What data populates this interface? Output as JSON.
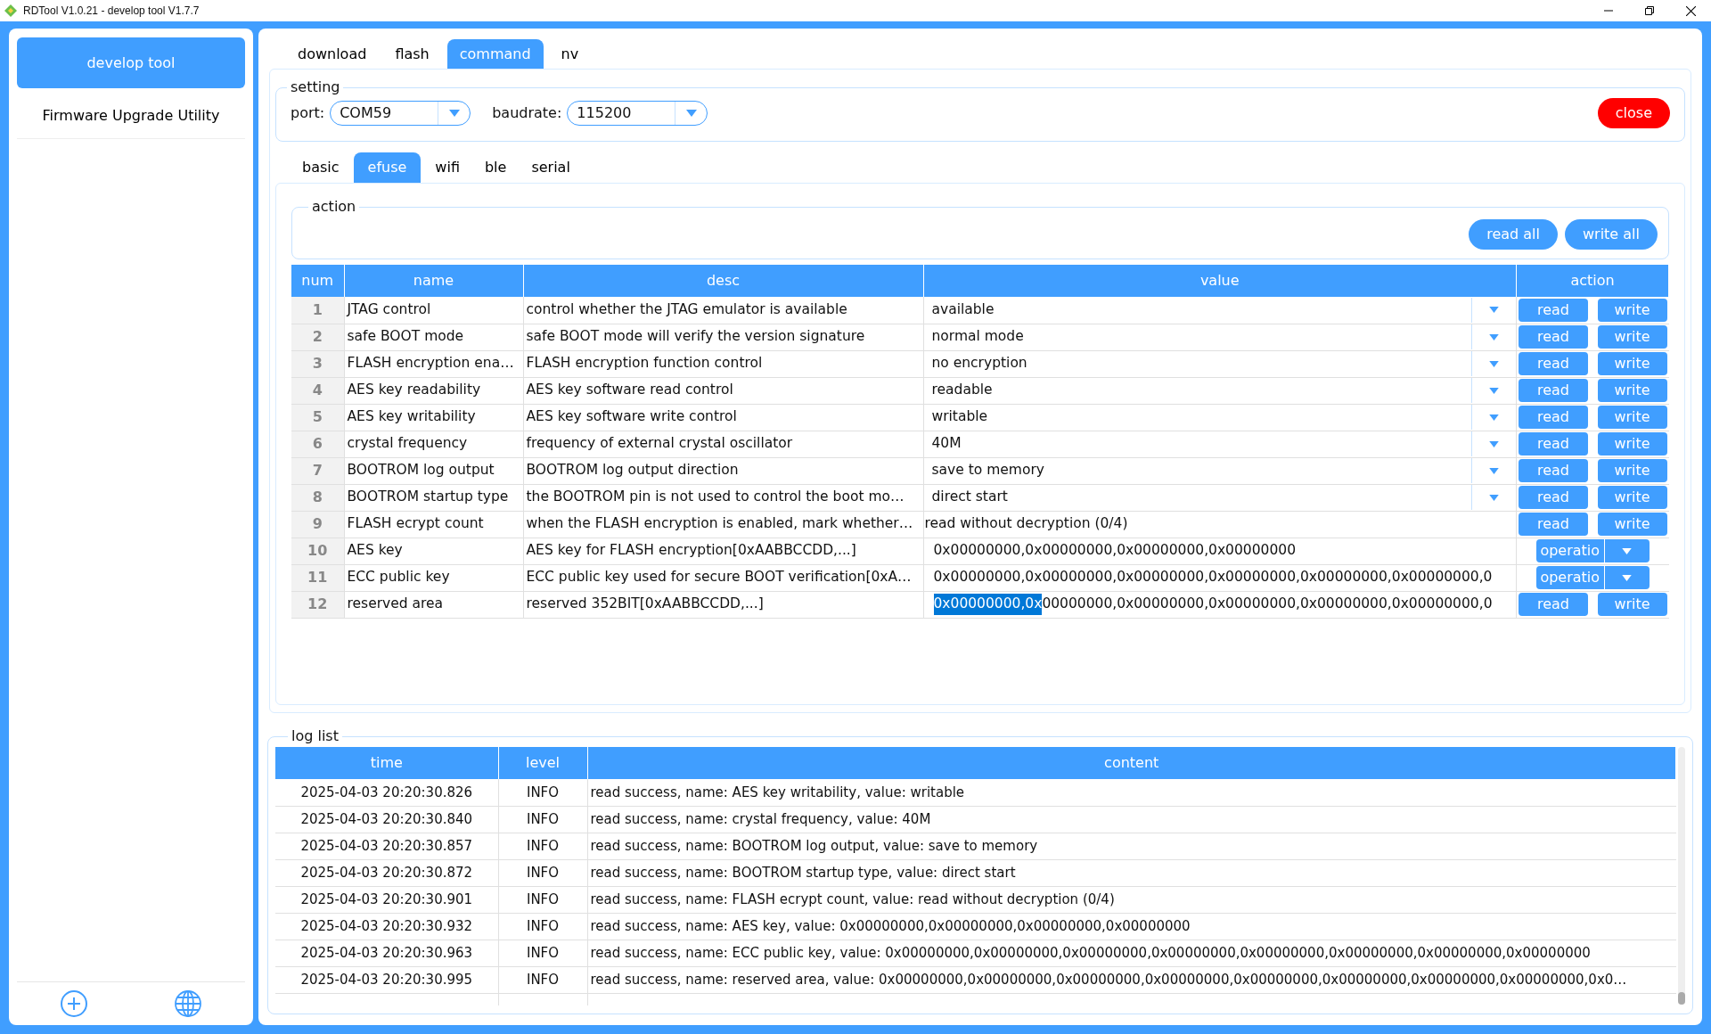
{
  "window": {
    "title": "RDTool V1.0.21 - develop tool V1.7.7"
  },
  "sidebar": {
    "items": [
      {
        "label": "develop tool",
        "selected": true
      },
      {
        "label": "Firmware Upgrade Utility",
        "selected": false
      }
    ]
  },
  "tabs": [
    {
      "label": "download",
      "selected": false
    },
    {
      "label": "flash",
      "selected": false
    },
    {
      "label": "command",
      "selected": true
    },
    {
      "label": "nv",
      "selected": false
    }
  ],
  "setting": {
    "legend": "setting",
    "port_label": "port:",
    "port_value": "COM59",
    "baudrate_label": "baudrate:",
    "baudrate_value": "115200",
    "close_button": "close"
  },
  "subtabs": [
    {
      "label": "basic",
      "selected": false
    },
    {
      "label": "efuse",
      "selected": true
    },
    {
      "label": "wifi",
      "selected": false
    },
    {
      "label": "ble",
      "selected": false
    },
    {
      "label": "serial",
      "selected": false
    }
  ],
  "action": {
    "legend": "action",
    "buttons": [
      "read all",
      "write all"
    ]
  },
  "table": {
    "columns": [
      "num",
      "name",
      "desc",
      "value",
      "action"
    ],
    "rows": [
      {
        "num": "1",
        "name": "JTAG control",
        "desc": "control whether the JTAG emulator is available",
        "kind": "dropdown",
        "value": "available",
        "action": {
          "kind": "buttons",
          "labels": [
            "read",
            "write"
          ]
        }
      },
      {
        "num": "2",
        "name": "safe BOOT mode",
        "desc": "safe BOOT mode will verify the version signature",
        "kind": "dropdown",
        "value": "normal mode",
        "action": {
          "kind": "buttons",
          "labels": [
            "read",
            "write"
          ]
        }
      },
      {
        "num": "3",
        "name": "FLASH encryption ena…",
        "desc": "FLASH encryption function control",
        "kind": "dropdown",
        "value": "no encryption",
        "action": {
          "kind": "buttons",
          "labels": [
            "read",
            "write"
          ]
        }
      },
      {
        "num": "4",
        "name": "AES key readability",
        "desc": "AES key software read control",
        "kind": "dropdown",
        "value": "readable",
        "action": {
          "kind": "buttons",
          "labels": [
            "read",
            "write"
          ]
        }
      },
      {
        "num": "5",
        "name": "AES key writability",
        "desc": "AES key software write control",
        "kind": "dropdown",
        "value": "writable",
        "action": {
          "kind": "buttons",
          "labels": [
            "read",
            "write"
          ]
        }
      },
      {
        "num": "6",
        "name": "crystal frequency",
        "desc": "frequency of external crystal oscillator",
        "kind": "dropdown",
        "value": "40M",
        "action": {
          "kind": "buttons",
          "labels": [
            "read",
            "write"
          ]
        }
      },
      {
        "num": "7",
        "name": "BOOTROM log output",
        "desc": "BOOTROM log output direction",
        "kind": "dropdown",
        "value": "save to memory",
        "action": {
          "kind": "buttons",
          "labels": [
            "read",
            "write"
          ]
        }
      },
      {
        "num": "8",
        "name": "BOOTROM startup type",
        "desc": "the BOOTROM pin is not used to control the boot mo…",
        "kind": "dropdown",
        "value": "direct start",
        "action": {
          "kind": "buttons",
          "labels": [
            "read",
            "write"
          ]
        }
      },
      {
        "num": "9",
        "name": "FLASH ecrypt count",
        "desc": "when the FLASH encryption is enabled, mark whether…",
        "kind": "text",
        "value": "read without decryption (0/4)",
        "action": {
          "kind": "buttons",
          "labels": [
            "read",
            "write"
          ]
        }
      },
      {
        "num": "10",
        "name": "AES key",
        "desc": "AES key for FLASH encryption[0xAABBCCDD,...]",
        "kind": "input",
        "value": "0x00000000,0x00000000,0x00000000,0x00000000",
        "action": {
          "kind": "menu",
          "label": "operatio"
        }
      },
      {
        "num": "11",
        "name": "ECC public key",
        "desc": "ECC public key used for secure BOOT verification[0xA…",
        "kind": "input",
        "value": "0x00000000,0x00000000,0x00000000,0x00000000,0x00000000,0x00000000,0",
        "action": {
          "kind": "menu",
          "label": "operatio"
        }
      },
      {
        "num": "12",
        "name": "reserved area",
        "desc": "reserved 352BIT[0xAABBCCDD,...]",
        "kind": "input",
        "value_selected": "0x00000000,0x",
        "value": "00000000,0x00000000,0x00000000,0x00000000,0x00000000,0",
        "action": {
          "kind": "buttons",
          "labels": [
            "read",
            "write"
          ]
        }
      }
    ]
  },
  "log": {
    "legend": "log list",
    "columns": [
      "time",
      "level",
      "content"
    ],
    "rows": [
      {
        "time": "2025-04-03 20:20:30.826",
        "level": "INFO",
        "content": "read success, name: AES key writability, value: writable"
      },
      {
        "time": "2025-04-03 20:20:30.840",
        "level": "INFO",
        "content": "read success, name: crystal frequency, value: 40M"
      },
      {
        "time": "2025-04-03 20:20:30.857",
        "level": "INFO",
        "content": "read success, name: BOOTROM log output, value: save to memory"
      },
      {
        "time": "2025-04-03 20:20:30.872",
        "level": "INFO",
        "content": "read success, name: BOOTROM startup type, value: direct start"
      },
      {
        "time": "2025-04-03 20:20:30.901",
        "level": "INFO",
        "content": "read success, name: FLASH ecrypt count, value: read without decryption (0/4)"
      },
      {
        "time": "2025-04-03 20:20:30.932",
        "level": "INFO",
        "content": "read success, name: AES key, value: 0x00000000,0x00000000,0x00000000,0x00000000"
      },
      {
        "time": "2025-04-03 20:20:30.963",
        "level": "INFO",
        "content": "read success, name: ECC public key, value: 0x00000000,0x00000000,0x00000000,0x00000000,0x00000000,0x00000000,0x00000000,0x00000000"
      },
      {
        "time": "2025-04-03 20:20:30.995",
        "level": "INFO",
        "content": "read success, name: reserved area, value: 0x00000000,0x00000000,0x00000000,0x00000000,0x00000000,0x00000000,0x00000000,0x00000000,0x0…"
      }
    ]
  }
}
